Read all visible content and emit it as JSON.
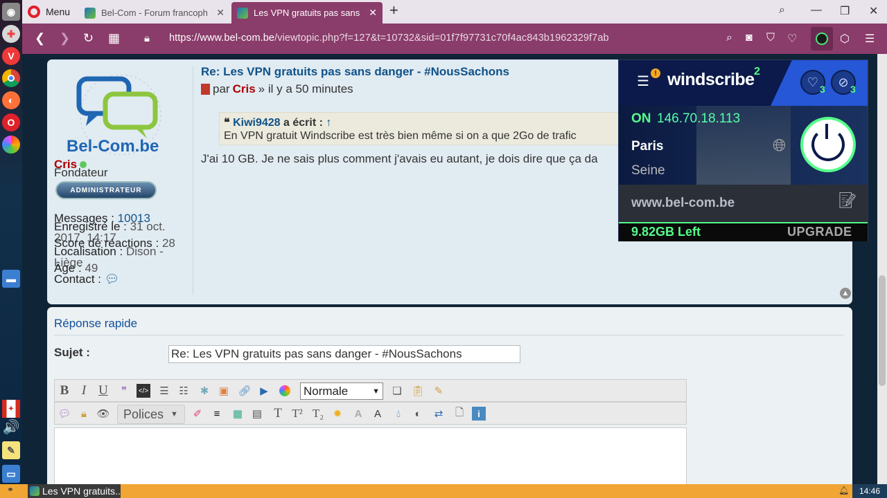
{
  "browser": {
    "menu_label": "Menu",
    "tabs": [
      {
        "label": "Bel-Com - Forum francoph"
      },
      {
        "label": "Les VPN gratuits pas sans"
      }
    ],
    "new_tab": "+",
    "url_domain": "https://www.bel-com.be",
    "url_path": "/viewtopic.php?f=127&t=10732&sid=01f7f97731c70f4ac843b1962329f7ab"
  },
  "post": {
    "logo_text": "Bel-Com.be",
    "username": "Cris",
    "rank": "Fondateur",
    "rank_badge": "ADMINISTRATEUR",
    "messages_label": "Messages :",
    "messages_value": "10013",
    "registered_label": "Enregistré le :",
    "registered_value": "31 oct. 2017, 14:17",
    "reactions_label": "Score de réactions :",
    "reactions_value": "28",
    "location_label": "Localisation :",
    "location_value": "Dison - Liège",
    "age_label": "Âge :",
    "age_value": "49",
    "contact_label": "Contact :",
    "title": "Re: Les VPN gratuits pas sans danger - #NousSachons",
    "by_prefix": "par",
    "author": "Cris",
    "time": "» il y a 50 minutes",
    "quote_author": "Kiwi9428",
    "quote_suffix": "a écrit :",
    "quote_arrow": "↑",
    "quote_text": "En VPN gratuit Windscribe est très bien même si on a que 2Go de trafic",
    "body": "J'ai 10 GB. Je ne sais plus comment j'avais eu autant, je dois dire que ça da"
  },
  "reply": {
    "title": "Réponse rapide",
    "subject_label": "Sujet :",
    "subject_value": "Re: Les VPN gratuits pas sans danger - #NousSachons",
    "size_select": "Normale",
    "font_dropdown": "Polices"
  },
  "windscribe": {
    "notification_badge": "!",
    "logo": "windscribe",
    "logo_sup": "2",
    "fav_count": "3",
    "block_count": "3",
    "status": "ON",
    "ip": "146.70.18.113",
    "city": "Paris",
    "region": "Seine",
    "site": "www.bel-com.be",
    "data_left": "9.82GB Left",
    "upgrade": "UPGRADE"
  },
  "taskbar": {
    "app_label": "Les VPN gratuits...",
    "clock": "14:46"
  }
}
